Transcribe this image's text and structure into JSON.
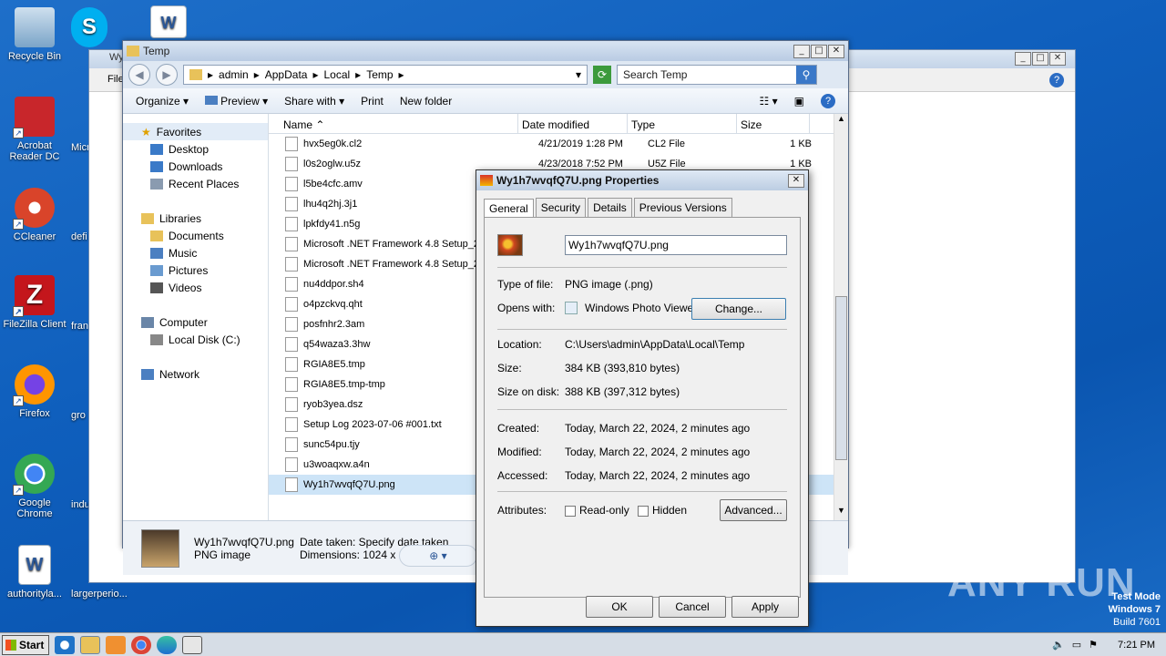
{
  "desktop": {
    "icons": [
      {
        "label": "Recycle Bin",
        "color": "#7aa4c8"
      },
      {
        "label": "Acrobat Reader DC",
        "color": "#c8262b"
      },
      {
        "label": "CCleaner",
        "color": "#d9442a"
      },
      {
        "label": "FileZilla Client",
        "color": "#c4161c"
      },
      {
        "label": "Firefox",
        "color": "#e66000"
      },
      {
        "label": "Google Chrome",
        "color": "#3a8f3a"
      },
      {
        "label": "authorityla...",
        "color": "#2b5797"
      }
    ],
    "partial": [
      "Micr",
      "defi",
      "fran",
      "gro",
      "indu",
      "largerperio..."
    ]
  },
  "back_window": {
    "title": "Wy",
    "menu": "File"
  },
  "explorer": {
    "title": "Temp",
    "breadcrumb": [
      "admin",
      "AppData",
      "Local",
      "Temp"
    ],
    "search_placeholder": "Search Temp",
    "toolbar": [
      "Organize",
      "Preview",
      "Share with",
      "Print",
      "New folder"
    ],
    "nav": {
      "favorites": "Favorites",
      "fav_items": [
        "Desktop",
        "Downloads",
        "Recent Places"
      ],
      "libraries": "Libraries",
      "lib_items": [
        "Documents",
        "Music",
        "Pictures",
        "Videos"
      ],
      "computer": "Computer",
      "comp_items": [
        "Local Disk (C:)"
      ],
      "network": "Network"
    },
    "columns": [
      "Name",
      "Date modified",
      "Type",
      "Size"
    ],
    "files": [
      {
        "name": "hvx5eg0k.cl2",
        "date": "4/21/2019 1:28 PM",
        "type": "CL2 File",
        "size": "1 KB"
      },
      {
        "name": "l0s2oglw.u5z",
        "date": "4/23/2018 7:52 PM",
        "type": "U5Z File",
        "size": "1 KB"
      },
      {
        "name": "l5be4cfc.amv",
        "date": "",
        "type": "",
        "size": ""
      },
      {
        "name": "lhu4q2hj.3j1",
        "date": "",
        "type": "",
        "size": ""
      },
      {
        "name": "lpkfdy41.n5g",
        "date": "",
        "type": "",
        "size": ""
      },
      {
        "name": "Microsoft .NET Framework 4.8 Setup_2",
        "date": "",
        "type": "",
        "size": ""
      },
      {
        "name": "Microsoft .NET Framework 4.8 Setup_2",
        "date": "",
        "type": "",
        "size": ""
      },
      {
        "name": "nu4ddpor.sh4",
        "date": "",
        "type": "",
        "size": ""
      },
      {
        "name": "o4pzckvq.qht",
        "date": "",
        "type": "",
        "size": ""
      },
      {
        "name": "posfnhr2.3am",
        "date": "",
        "type": "",
        "size": ""
      },
      {
        "name": "q54waza3.3hw",
        "date": "",
        "type": "",
        "size": ""
      },
      {
        "name": "RGIA8E5.tmp",
        "date": "",
        "type": "",
        "size": ""
      },
      {
        "name": "RGIA8E5.tmp-tmp",
        "date": "",
        "type": "",
        "size": ""
      },
      {
        "name": "ryob3yea.dsz",
        "date": "",
        "type": "",
        "size": ""
      },
      {
        "name": "Setup Log 2023-07-06 #001.txt",
        "date": "",
        "type": "",
        "size": ""
      },
      {
        "name": "sunc54pu.tjy",
        "date": "",
        "type": "",
        "size": ""
      },
      {
        "name": "u3woaqxw.a4n",
        "date": "",
        "type": "",
        "size": ""
      },
      {
        "name": "Wy1h7wvqfQ7U.png",
        "date": "",
        "type": "",
        "size": ""
      }
    ],
    "status": {
      "filename": "Wy1h7wvqfQ7U.png",
      "filetype": "PNG image",
      "date_taken": "Date taken: Specify date taken",
      "dimensions": "Dimensions: 1024 x 1024"
    }
  },
  "props": {
    "title": "Wy1h7wvqfQ7U.png Properties",
    "tabs": [
      "General",
      "Security",
      "Details",
      "Previous Versions"
    ],
    "filename": "Wy1h7wvqfQ7U.png",
    "type_label": "Type of file:",
    "type_value": "PNG image (.png)",
    "opens_label": "Opens with:",
    "opens_value": "Windows Photo Viewer",
    "change": "Change...",
    "location_label": "Location:",
    "location_value": "C:\\Users\\admin\\AppData\\Local\\Temp",
    "size_label": "Size:",
    "size_value": "384 KB (393,810 bytes)",
    "disk_label": "Size on disk:",
    "disk_value": "388 KB (397,312 bytes)",
    "created_label": "Created:",
    "created_value": "Today, March 22, 2024, 2 minutes ago",
    "modified_label": "Modified:",
    "modified_value": "Today, March 22, 2024, 2 minutes ago",
    "accessed_label": "Accessed:",
    "accessed_value": "Today, March 22, 2024, 2 minutes ago",
    "attr_label": "Attributes:",
    "readonly": "Read-only",
    "hidden": "Hidden",
    "advanced": "Advanced...",
    "ok": "OK",
    "cancel": "Cancel",
    "apply": "Apply"
  },
  "taskbar": {
    "start": "Start",
    "time": "7:21 PM"
  },
  "watermark": "ANY RUN",
  "testmode": [
    "Test Mode",
    "Windows 7",
    "Build 7601"
  ]
}
